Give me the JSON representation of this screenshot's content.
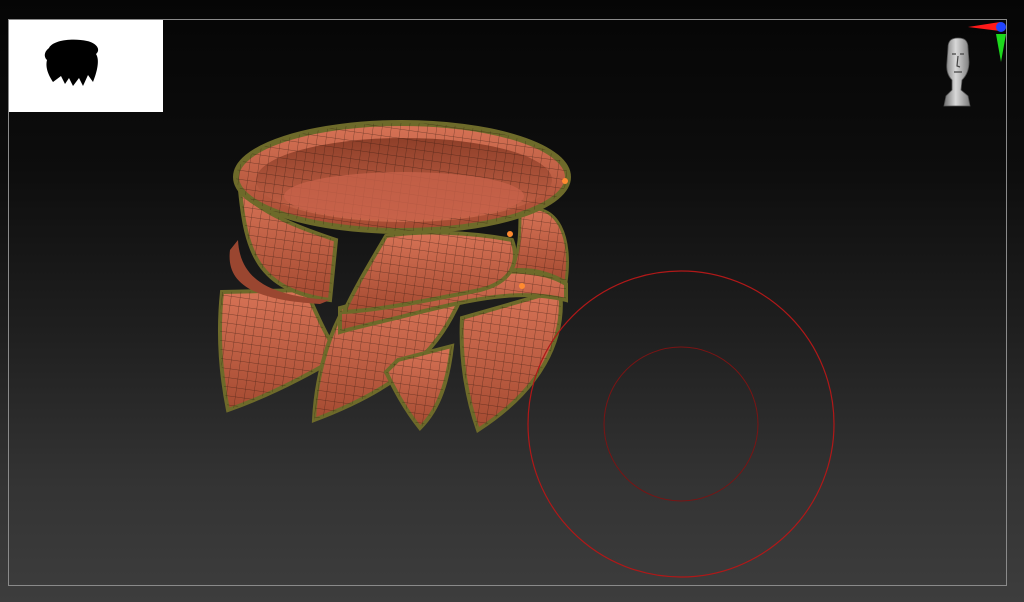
{
  "app": {
    "viewport": "3d-viewport",
    "model": "collar-mesh"
  },
  "icons": {
    "navigator": "head-navigator-icon",
    "axis_gizmo": "axis-gizmo-icon",
    "thumbnail": "silhouette-thumbnail",
    "brush": "brush-cursor-icon"
  },
  "colors": {
    "mesh": "#b65a3e",
    "edge_trim": "#6d6a2a",
    "wire": "#2a140d",
    "brush_ring": "#b01818",
    "axis_x": "#ff2020",
    "axis_y": "#20e020",
    "axis_z": "#2040ff"
  }
}
